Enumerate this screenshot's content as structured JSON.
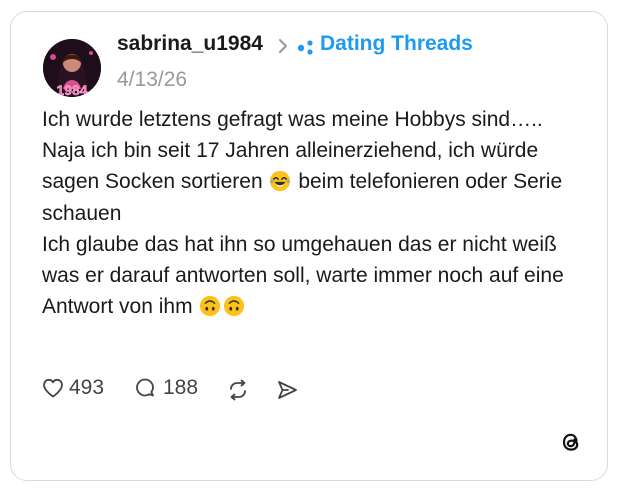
{
  "post": {
    "author": "sabrina_u1984",
    "topic": "Dating Threads",
    "date": "4/13/26",
    "avatar_text": "1984",
    "text": "Ich wurde letztens gefragt was meine Hobbys sind…..\nNaja ich bin seit 17 Jahren alleinerziehend, ich würde sagen Socken sortieren",
    "text_after_laugh": " beim telefonieren oder Serie schauen\nIch glaube das hat ihn so umgehauen das er nicht weiß was er darauf antworten soll, warte immer noch auf eine Antwort von ihm ",
    "stats": {
      "likes": "493",
      "replies": "188"
    }
  },
  "colors": {
    "accent": "#1d9bf0",
    "text": "#1a1a1a",
    "muted": "#999999",
    "border": "#d9d9d9"
  },
  "icons": [
    "heart-icon",
    "reply-icon",
    "repost-icon",
    "share-icon",
    "threads-logo-icon",
    "topic-icon",
    "chevron-right-icon"
  ]
}
